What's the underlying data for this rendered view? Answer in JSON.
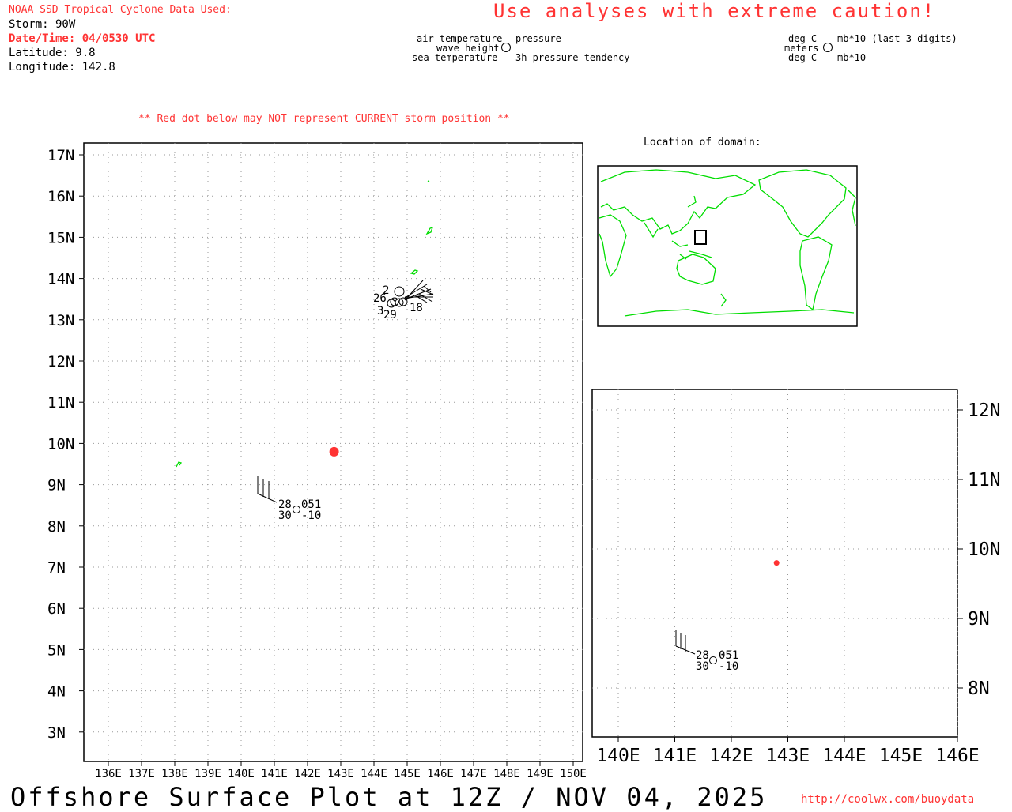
{
  "header": {
    "source_label": "NOAA SSD Tropical Cyclone Data Used:",
    "storm": "Storm: 90W",
    "datetime": "Date/Time: 04/0530 UTC",
    "latitude": "Latitude: 9.8",
    "longitude": "Longitude: 142.8",
    "caution": "Use analyses with extreme caution!"
  },
  "legend": {
    "left": {
      "air_temperature": "air temperature",
      "wave_height": "wave height",
      "sea_temperature": "sea temperature",
      "pressure": "pressure",
      "pressure_tendency": "3h pressure tendency"
    },
    "right": {
      "deg_c_top": "deg C",
      "meters": "meters",
      "deg_c_bottom": "deg C",
      "mb_last3": "mb*10 (last 3 digits)",
      "mb": "mb*10"
    }
  },
  "warning": "** Red dot below may NOT represent CURRENT storm position **",
  "inset_title": "Location of domain:",
  "main_map": {
    "lat_labels": [
      "17N",
      "16N",
      "15N",
      "14N",
      "13N",
      "12N",
      "11N",
      "10N",
      "9N",
      "8N",
      "7N",
      "6N",
      "5N",
      "4N",
      "3N"
    ],
    "lon_labels": [
      "136E",
      "137E",
      "138E",
      "139E",
      "140E",
      "141E",
      "142E",
      "143E",
      "144E",
      "145E",
      "146E",
      "147E",
      "148E",
      "149E",
      "150E"
    ],
    "storm_position": {
      "lat": 9.8,
      "lon": 142.8
    },
    "station": {
      "air_temp": "28",
      "pressure": "051",
      "sea_temp": "30",
      "tendency": "-10"
    },
    "cluster_labels": [
      "2",
      "26",
      "3",
      "29",
      "18"
    ]
  },
  "zoom_map": {
    "lat_labels": [
      "12N",
      "11N",
      "10N",
      "9N",
      "8N"
    ],
    "lon_labels": [
      "140E",
      "141E",
      "142E",
      "143E",
      "144E",
      "145E",
      "146E"
    ],
    "station": {
      "air_temp": "28",
      "pressure": "051",
      "sea_temp": "30",
      "tendency": "-10"
    }
  },
  "footer": {
    "title": "Offshore Surface Plot at 12Z / NOV 04, 2025",
    "url": "http://coolwx.com/buoydata"
  },
  "colors": {
    "accent": "#ff3333",
    "land": "#00dd00"
  }
}
